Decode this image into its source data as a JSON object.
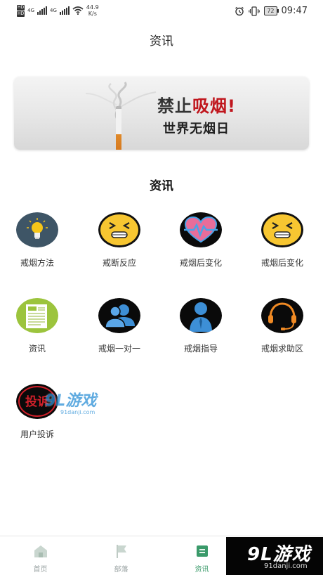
{
  "status_bar": {
    "hd_labels": [
      "HD",
      "HD"
    ],
    "net_labels": [
      "4G",
      "4G"
    ],
    "speed_value": "44.9",
    "speed_unit": "K/s",
    "battery": "72",
    "time": "09:47"
  },
  "page": {
    "title": "资讯"
  },
  "banner": {
    "line1_prefix": "禁止",
    "line1_highlight": "吸烟!",
    "line2": "世界无烟日"
  },
  "section": {
    "title": "资讯"
  },
  "grid": {
    "items": [
      {
        "label": "戒烟方法",
        "icon": "lightbulb-icon"
      },
      {
        "label": "戒断反应",
        "icon": "squint-face-icon"
      },
      {
        "label": "戒烟后变化",
        "icon": "heart-pulse-icon"
      },
      {
        "label": "戒烟后变化",
        "icon": "squint-face-icon"
      },
      {
        "label": "资讯",
        "icon": "newspaper-icon"
      },
      {
        "label": "戒烟一对一",
        "icon": "users-icon"
      },
      {
        "label": "戒烟指导",
        "icon": "person-icon"
      },
      {
        "label": "戒烟求助区",
        "icon": "headset-icon"
      },
      {
        "label": "用户投诉",
        "icon": "complaint-icon",
        "icon_text": "投诉"
      }
    ]
  },
  "tabs": [
    {
      "label": "首页",
      "icon": "home-icon",
      "active": false
    },
    {
      "label": "部落",
      "icon": "flag-icon",
      "active": false
    },
    {
      "label": "资讯",
      "icon": "news-icon",
      "active": true
    }
  ],
  "watermarks": {
    "big": "9L游戏",
    "small": "91danji.com",
    "light_big": "9L游戏",
    "light_small": "91danji.com"
  },
  "colors": {
    "accent": "#3a9a6a",
    "banner_red": "#c0161d",
    "tab_inactive": "#9aa3a3"
  }
}
